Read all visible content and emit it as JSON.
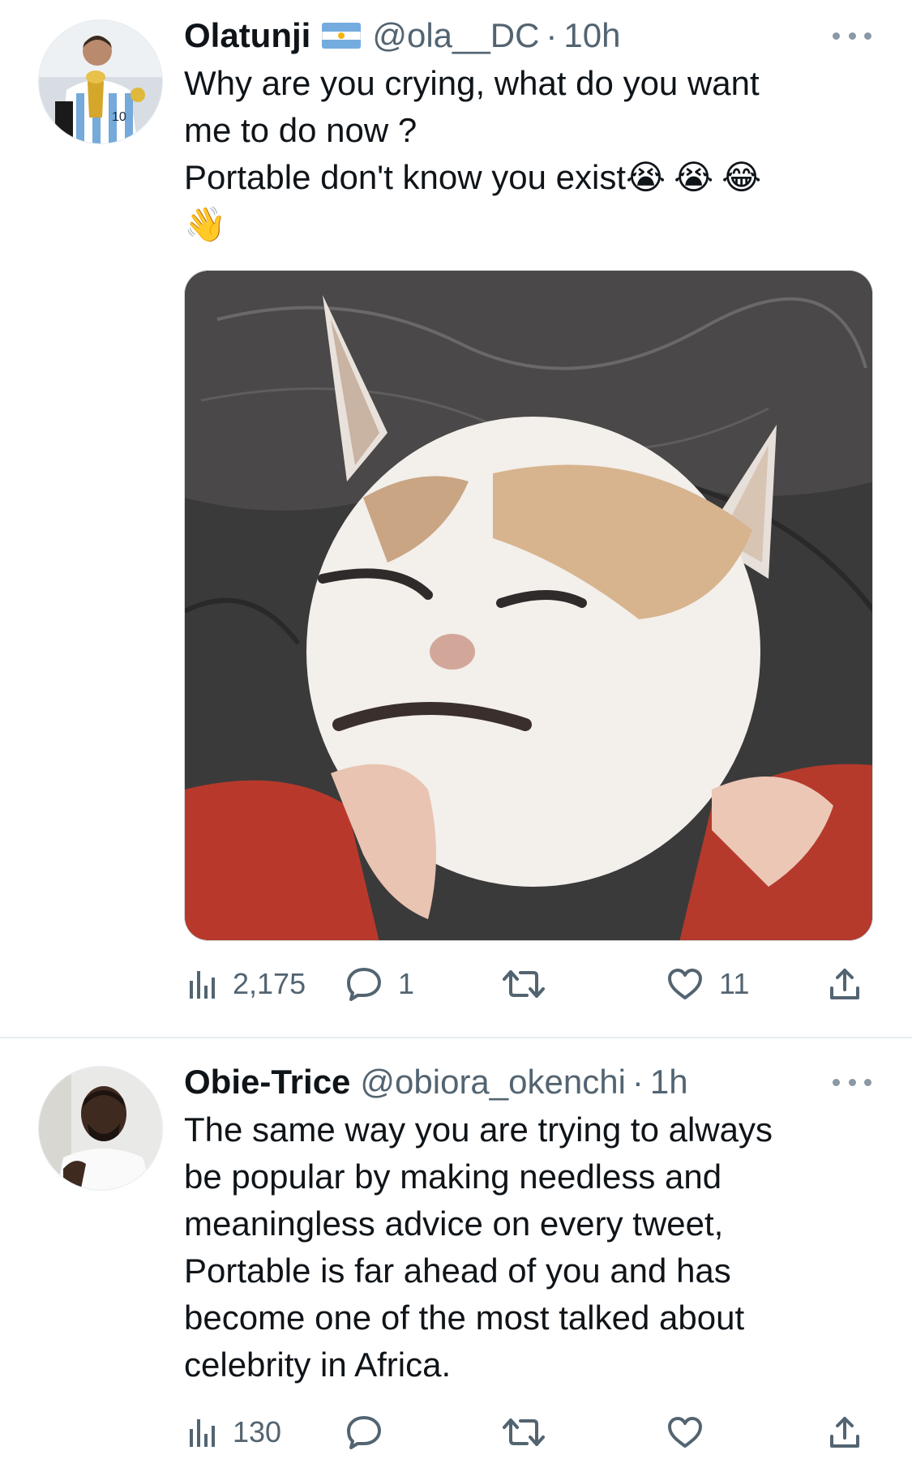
{
  "tweets": [
    {
      "display_name": "Olatunji",
      "flag_icon": "argentina-flag-icon",
      "handle": "@ola__DC",
      "separator": "·",
      "time": "10h",
      "text_lines": [
        "Why are you crying, what do you want",
        "me to do now ?",
        "Portable don't know you exist"
      ],
      "emojis": [
        "😭",
        "😭",
        "😂",
        "👋"
      ],
      "media": {
        "subject": "cat-shrug-meme-icon"
      },
      "stats": {
        "views": "2,175",
        "replies": "1",
        "retweets": "",
        "likes": "11"
      }
    },
    {
      "display_name": "Obie-Trice",
      "handle": "@obiora_okenchi",
      "separator": "·",
      "time": "1h",
      "text_lines": [
        "The same way you are trying to always",
        "be popular by making needless and",
        "meaningless advice on every tweet,",
        "Portable is far ahead of you and has",
        "become one of the most talked about",
        "celebrity in Africa."
      ],
      "stats": {
        "views": "130",
        "replies": "",
        "retweets": "",
        "likes": ""
      }
    }
  ],
  "colors": {
    "text": "#0f1419",
    "secondary": "#536471",
    "divider": "#e6ecf0",
    "flag_blue": "#74acdf"
  }
}
